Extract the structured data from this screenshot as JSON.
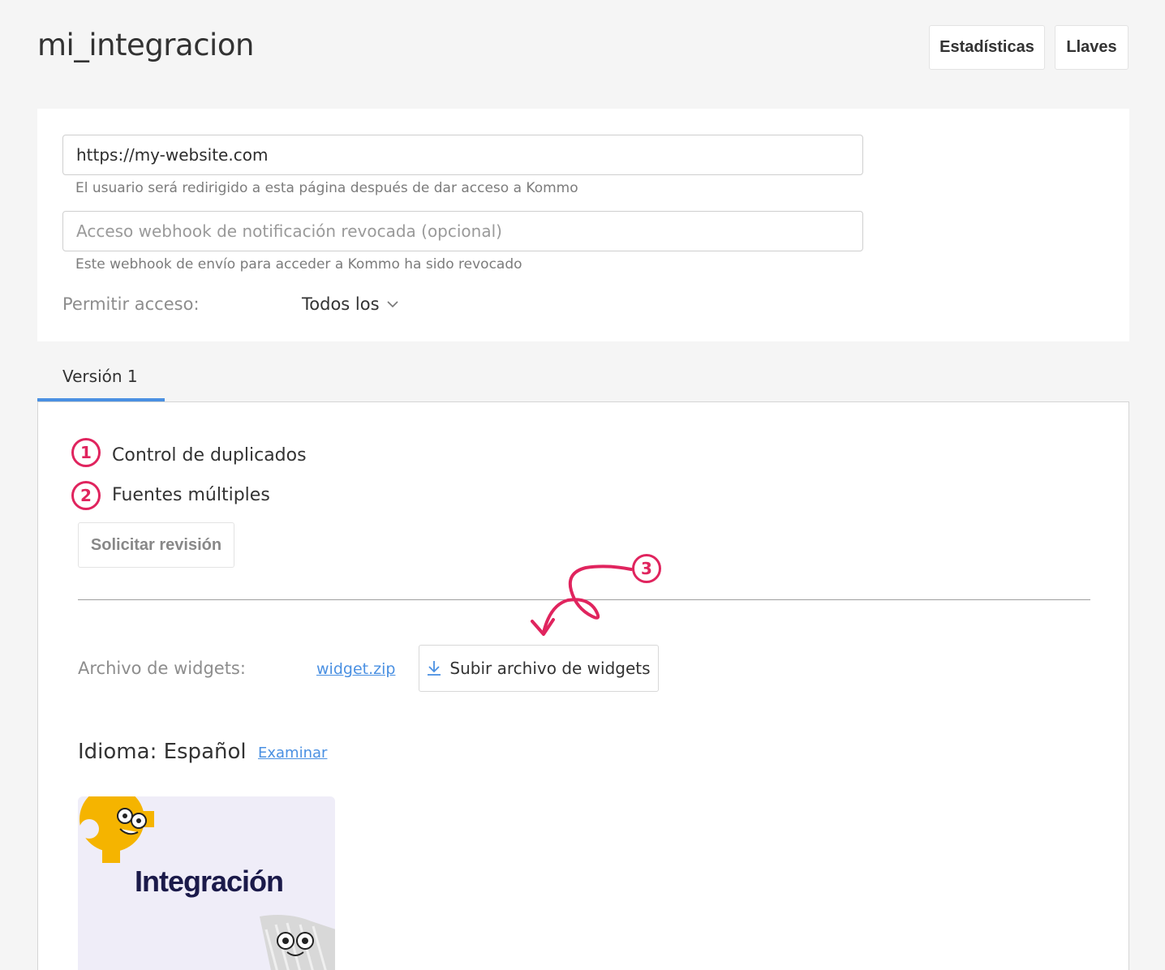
{
  "header": {
    "title": "mi_integracion",
    "stats_button": "Estadísticas",
    "keys_button": "Llaves"
  },
  "settings": {
    "redirect_url_value": "https://my-website.com",
    "redirect_url_hint": "El usuario será redirigido a esta página después de dar acceso a Kommo",
    "webhook_placeholder": "Acceso webhook de notificación revocada (opcional)",
    "webhook_hint": "Este webhook de envío para acceder a Kommo ha sido revocado",
    "access_label": "Permitir acceso:",
    "access_value": "Todos los"
  },
  "tabs": [
    {
      "label": "Versión 1",
      "active": true
    }
  ],
  "version": {
    "features": [
      {
        "badge": "1",
        "label": "Control de duplicados"
      },
      {
        "badge": "2",
        "label": "Fuentes múltiples"
      }
    ],
    "review_button": "Solicitar revisión",
    "file_label": "Archivo de widgets:",
    "file_link": "widget.zip",
    "upload_button": "Subir archivo de widgets",
    "annotation_badge": "3",
    "language_label": "Idioma: Español",
    "language_link": "Examinar",
    "thumbnail_title": "Integración"
  },
  "colors": {
    "accent": "#4a90e2",
    "annotation": "#e0245e",
    "thumb_bg": "#efedf8",
    "gear": "#f5b400"
  },
  "icons": [
    "chevron-down-icon",
    "download-icon",
    "gear-mascot-icon",
    "robot-mascot-icon",
    "curved-arrow-icon"
  ]
}
